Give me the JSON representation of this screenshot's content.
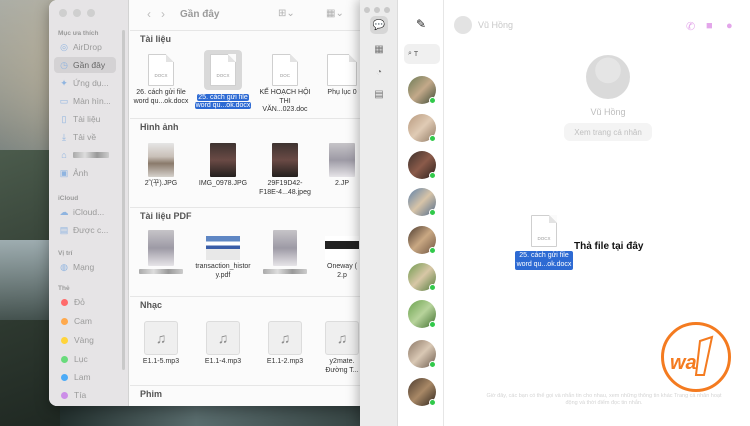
{
  "finder": {
    "title": "Gần đây",
    "sidebar": {
      "sections": {
        "favorites": "Mục ưa thích",
        "icloud": "iCloud",
        "locations": "Vị trí",
        "tags": "Thẻ"
      },
      "favorites": [
        {
          "label": "AirDrop",
          "icon": "airdrop-icon",
          "active": false
        },
        {
          "label": "Gần đây",
          "icon": "clock-icon",
          "active": true
        },
        {
          "label": "Ứng dụ...",
          "icon": "apps-icon",
          "active": false
        },
        {
          "label": "Màn hìn...",
          "icon": "desktop-icon",
          "active": false
        },
        {
          "label": "Tài liệu",
          "icon": "document-icon",
          "active": false
        },
        {
          "label": "Tải về",
          "icon": "download-icon",
          "active": false
        },
        {
          "label": "",
          "icon": "home-icon",
          "active": false
        },
        {
          "label": "Ảnh",
          "icon": "photo-icon",
          "active": false
        }
      ],
      "icloud": [
        {
          "label": "iCloud...",
          "icon": "cloud-icon"
        },
        {
          "label": "Được c...",
          "icon": "shared-folder-icon"
        }
      ],
      "locations": [
        {
          "label": "Mạng",
          "icon": "network-icon"
        }
      ],
      "tags": [
        {
          "label": "Đỏ",
          "color": "#ff6b6b"
        },
        {
          "label": "Cam",
          "color": "#ffa94d"
        },
        {
          "label": "Vàng",
          "color": "#ffd43b"
        },
        {
          "label": "Lục",
          "color": "#69db7c"
        },
        {
          "label": "Lam",
          "color": "#4dabf7"
        },
        {
          "label": "Tía",
          "color": "#cc8ee8"
        }
      ]
    },
    "sections": {
      "documents": "Tài liệu",
      "images": "Hình ảnh",
      "pdf": "Tài liệu PDF",
      "music": "Nhạc",
      "movies": "Phim"
    },
    "documents": [
      {
        "line1": "26. cách gửi file",
        "line2": "word qu...ok.docx",
        "type": "DOCX",
        "selected": false
      },
      {
        "line1": "25. cách gửi file",
        "line2": "word qu...ok.docx",
        "type": "DOCX",
        "selected": true
      },
      {
        "line1": "KẾ HOẠCH HỘI",
        "line2": "THI VĂN...023.doc",
        "type": "DOC",
        "selected": false
      },
      {
        "line1": "Phụ lục 0",
        "line2": "",
        "type": "",
        "selected": false
      }
    ],
    "images": [
      {
        "line1": "2̃ (꾸).JPG",
        "line2": ""
      },
      {
        "line1": "IMG_0978.JPG",
        "line2": ""
      },
      {
        "line1": "29F19D42-",
        "line2": "F18E-4...48.jpeg"
      },
      {
        "line1": "2.JP",
        "line2": ""
      }
    ],
    "pdfs": [
      {
        "line1": "",
        "line2": ""
      },
      {
        "line1": "transaction_histor",
        "line2": "y.pdf"
      },
      {
        "line1": "",
        "line2": ""
      },
      {
        "line1": "Oneway (",
        "line2": "2.p"
      }
    ],
    "music": [
      {
        "line1": "E1.1-5.mp3",
        "line2": ""
      },
      {
        "line1": "E1.1-4.mp3",
        "line2": ""
      },
      {
        "line1": "E1.1-2.mp3",
        "line2": ""
      },
      {
        "line1": "y2mate.",
        "line2": "Đường T..."
      }
    ]
  },
  "messenger": {
    "contact_name": "Vũ Hồng",
    "search_text": "T",
    "profile_name": "Vũ Hồng",
    "profile_button": "Xem trang cá nhân",
    "drag_file": {
      "line1": "25. cách gửi file",
      "line2": "word qu...ok.docx",
      "type": "DOCX"
    },
    "drop_prompt": "Thả file tại đây",
    "footer_note": "Giờ đây, các bạn có thể gọi và nhắn tin cho nhau, xem những thông tin khác\nTrang cá nhân hoạt động và thời điểm đọc tin nhắn.",
    "accent_color": "#e3a6ea"
  },
  "logo": {
    "text": "way",
    "color": "#f47b20"
  }
}
